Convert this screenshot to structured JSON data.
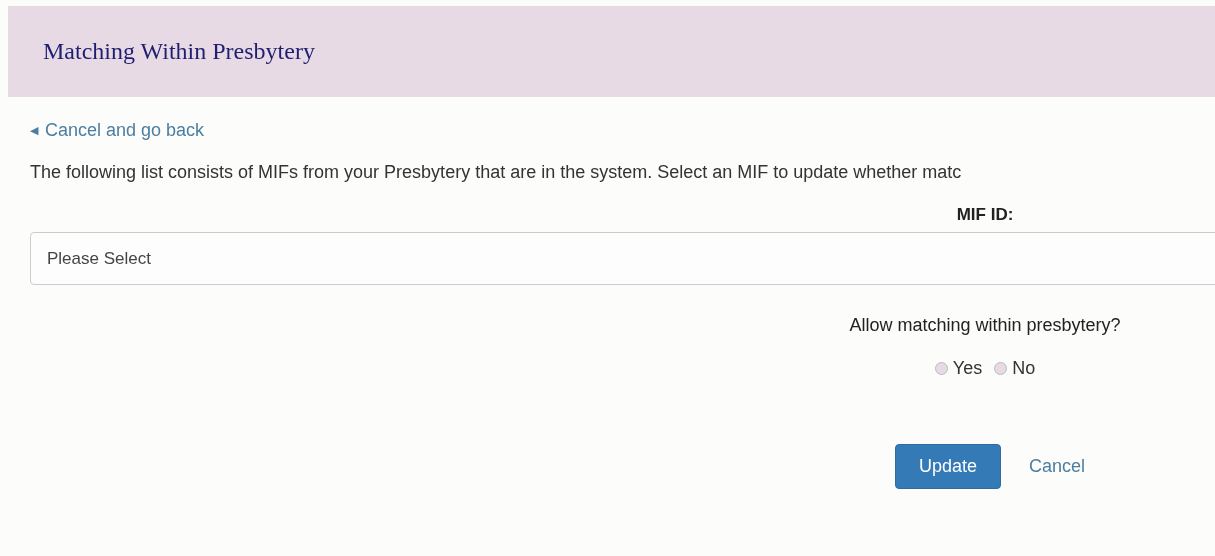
{
  "header": {
    "title": "Matching Within Presbytery"
  },
  "back_link": {
    "icon": "◀",
    "label": "Cancel and go back"
  },
  "intro": "The following list consists of MIFs from your Presbytery that are in the system. Select an MIF to update whether matc",
  "mif_field": {
    "label": "MIF ID:",
    "placeholder": "Please Select"
  },
  "question": "Allow matching within presbytery?",
  "options": [
    {
      "label": "Yes",
      "selected": false
    },
    {
      "label": "No",
      "selected": false
    }
  ],
  "buttons": [
    {
      "kind": "primary",
      "label": "Update"
    },
    {
      "kind": "link",
      "label": "Cancel"
    }
  ]
}
